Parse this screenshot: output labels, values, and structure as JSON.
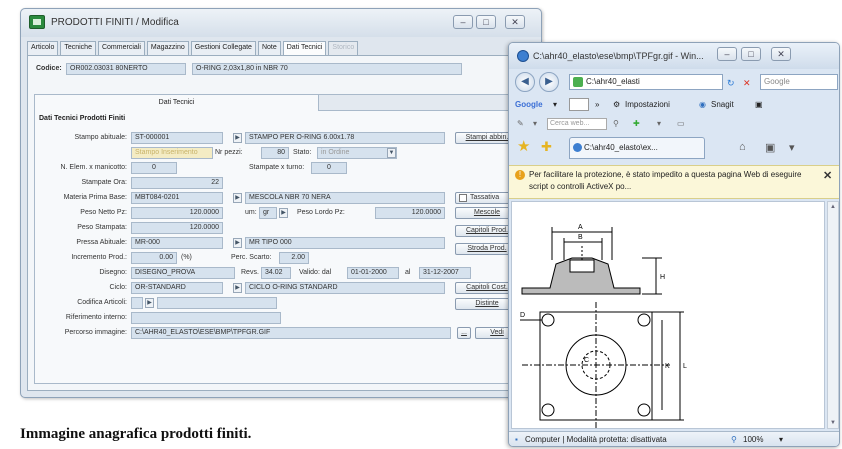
{
  "main_window": {
    "title": "PRODOTTI FINITI / Modifica",
    "tabs": [
      {
        "label": "Articolo",
        "state": "normal"
      },
      {
        "label": "Tecniche",
        "state": "normal"
      },
      {
        "label": "Commerciali",
        "state": "normal"
      },
      {
        "label": "Magazzino",
        "state": "normal"
      },
      {
        "label": "Gestioni Collegate",
        "state": "normal"
      },
      {
        "label": "Note",
        "state": "normal"
      },
      {
        "label": "Dati Tecnici",
        "state": "active"
      },
      {
        "label": "Storico",
        "state": "disabled"
      }
    ],
    "codice_label": "Codice:",
    "codice_value": "OR002.03031 80NERTO",
    "descrizione_value": "O-RING 2,03x1,80 in NBR 70",
    "subtab_label": "Dati Tecnici",
    "section_title": "Dati Tecnici Prodotti Finiti",
    "fields": {
      "stampo_label": "Stampo abituale:",
      "stampo_code": "ST-000001",
      "stampo_desc": "STAMPO PER O-RING 6.00x1.78",
      "stampi_button": "Stampi abbin.",
      "stampo_sub_value": "Stampo Inserimento",
      "nr_pezzi_label": "Nr pezzi:",
      "nr_pezzi_value": "80",
      "stato_label": "Stato:",
      "stato_value": "in Ordine",
      "elem_label": "N. Elem. x manicotto:",
      "elem_value": "0",
      "stampate_label": "Stampate x turno:",
      "stampate_value": "0",
      "stampate_ora_label": "Stampate Ora:",
      "stampate_ora_value": "22",
      "materia_label": "Materia Prima Base:",
      "materia_code": "MBT084-0201",
      "materia_desc": "MESCOLA NBR 70 NERA",
      "tassativa_label": "Tassativa",
      "peso_netto_label": "Peso Netto Pz:",
      "peso_netto_value": "120.0000",
      "um_label": "um:",
      "um_value": "gr",
      "peso_lordo_label": "Peso Lordo Pz:",
      "peso_lordo_value": "120.0000",
      "mescole_button": "Mescole",
      "peso_stampata_label": "Peso Stampata:",
      "peso_stampata_value": "120.0000",
      "capitoli_prod_button": "Capitoli Prod.",
      "pressa_label": "Pressa Abituale:",
      "pressa_code": "MR-000",
      "pressa_desc": "MR TIPO 000",
      "stroda_button": "Stroda Prod.",
      "incremento_label": "Incremento Prod.:",
      "incremento_value": "0.00",
      "incremento_unit": "(%)",
      "perc_scarto_label": "Perc. Scarto:",
      "perc_scarto_value": "2.00",
      "disegno_label": "Disegno:",
      "disegno_value": "DISEGNO_PROVA",
      "revs_label": "Revs.",
      "revs_value": "34.02",
      "valido_label": "Valido: dal",
      "valido_dal": "01-01-2000",
      "valido_al_label": "al",
      "valido_al": "31-12-2007",
      "ciclo_label": "Ciclo:",
      "ciclo_code": "OR-STANDARD",
      "ciclo_desc": "CICLO O-RING STANDARD",
      "capitoli_cost_button": "Capitoli Cost.",
      "codifica_label": "Codifica Articoli:",
      "distinte_button": "Distinte",
      "riferimento_label": "Riferimento interno:",
      "percorso_label": "Percorso immagine:",
      "percorso_value": "C:\\AHR40_ELASTO\\ESE\\BMP\\TPFGR.GIF",
      "vedi_button": "Vedi"
    }
  },
  "caption": "Immagine anagrafica prodotti finiti.",
  "ie_window": {
    "title": "C:\\ahr40_elasto\\ese\\bmp\\TPFgr.gif - Win...",
    "address": "C:\\ahr40_elasti",
    "search_placeholder": "Google",
    "google_label": "Google",
    "impostazioni_label": "Impostazioni",
    "snagit_label": "Snagit",
    "cerca_placeholder": "Cerca web...",
    "tab_label": "C:\\ahr40_elasto\\ex...",
    "info_text": "Per facilitare la protezione, è stato impedito a questa pagina Web di eseguire script o controlli ActiveX po...",
    "status_computer": "Computer | Modalità protetta: disattivata",
    "status_zoom": "100%"
  },
  "drawing_labels": {
    "top_a": "A",
    "top_b": "B",
    "side_h": "H",
    "side_k": "K",
    "side_l": "L",
    "hole_d": "D",
    "center_c": "C"
  }
}
